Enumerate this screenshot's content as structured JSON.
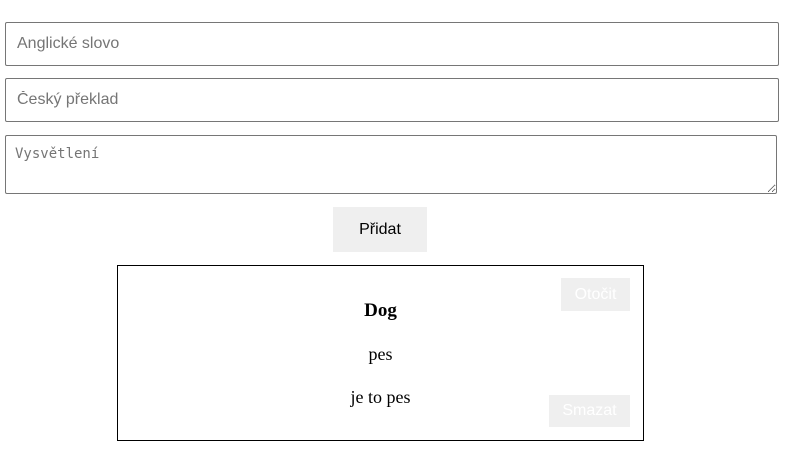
{
  "form": {
    "word_placeholder": "Anglické slovo",
    "translation_placeholder": "Český překlad",
    "explanation_placeholder": "Vysvětlení",
    "add_label": "Přidat"
  },
  "card": {
    "word": "Dog",
    "translation": "pes",
    "explanation": "je to pes",
    "flip_label": "Otočit",
    "delete_label": "Smazat"
  },
  "colors": {
    "button_bg": "#efefef",
    "border": "#767676",
    "card_border": "#000000"
  }
}
